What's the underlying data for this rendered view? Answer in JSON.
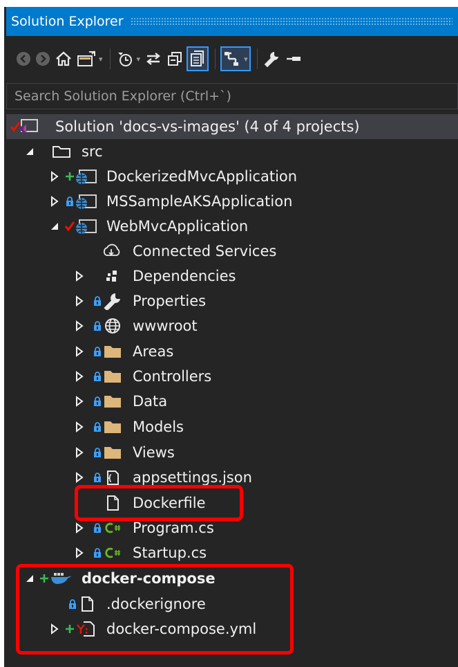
{
  "panel": {
    "title": "Solution Explorer",
    "search_placeholder": "Search Solution Explorer (Ctrl+`)"
  },
  "toolbar": {
    "buttons": [
      {
        "name": "back-icon",
        "state": "disabled"
      },
      {
        "name": "forward-icon",
        "state": "disabled"
      },
      {
        "name": "home-icon",
        "state": "normal"
      },
      {
        "name": "switch-views-icon",
        "state": "normal",
        "dropdown": true
      },
      {
        "name": "pending-changes-filter-icon",
        "state": "normal",
        "dropdown": true
      },
      {
        "name": "sync-with-active-document-icon",
        "state": "normal"
      },
      {
        "name": "collapse-all-icon",
        "state": "normal"
      },
      {
        "name": "show-all-files-icon",
        "state": "pressed"
      },
      {
        "name": "preview-selected-items-icon",
        "state": "pressed",
        "dropdown": true
      },
      {
        "name": "properties-wrench-icon",
        "state": "normal"
      },
      {
        "name": "pin-icon",
        "state": "normal"
      }
    ],
    "dropdown_glyph": "▾"
  },
  "tree": {
    "solution": {
      "label": "Solution 'docs-vs-images' (4 of 4 projects)",
      "status": "checked-in"
    },
    "src": {
      "label": "src",
      "expanded": true
    },
    "projects": [
      {
        "label": "DockerizedMvcApplication",
        "status": "added",
        "expanded": false
      },
      {
        "label": "MSSampleAKSApplication",
        "status": "locked",
        "expanded": false
      },
      {
        "label": "WebMvcApplication",
        "status": "checked-in",
        "expanded": true
      }
    ],
    "web_items": [
      {
        "label": "Connected Services",
        "icon": "connected-services-icon",
        "status": "none",
        "expandable": false
      },
      {
        "label": "Dependencies",
        "icon": "dependencies-icon",
        "status": "none",
        "expandable": true
      },
      {
        "label": "Properties",
        "icon": "wrench-icon",
        "status": "locked",
        "expandable": true
      },
      {
        "label": "wwwroot",
        "icon": "globe-icon",
        "status": "locked",
        "expandable": true
      },
      {
        "label": "Areas",
        "icon": "folder-icon",
        "status": "locked",
        "expandable": true
      },
      {
        "label": "Controllers",
        "icon": "folder-icon",
        "status": "locked",
        "expandable": true
      },
      {
        "label": "Data",
        "icon": "folder-icon",
        "status": "locked",
        "expandable": true
      },
      {
        "label": "Models",
        "icon": "folder-icon",
        "status": "locked",
        "expandable": true
      },
      {
        "label": "Views",
        "icon": "folder-icon",
        "status": "locked",
        "expandable": true
      },
      {
        "label": "appsettings.json",
        "icon": "json-file-icon",
        "status": "locked",
        "expandable": true
      },
      {
        "label": "Dockerfile",
        "icon": "file-icon",
        "status": "none",
        "expandable": false
      },
      {
        "label": "Program.cs",
        "icon": "csharp-file-icon",
        "status": "locked",
        "expandable": true
      },
      {
        "label": "Startup.cs",
        "icon": "csharp-file-icon",
        "status": "locked",
        "expandable": true
      }
    ],
    "compose": {
      "label": "docker-compose",
      "status": "added",
      "expanded": true
    },
    "compose_items": [
      {
        "label": ".dockerignore",
        "icon": "file-icon",
        "status": "locked",
        "expandable": false
      },
      {
        "label": "docker-compose.yml",
        "icon": "yaml-file-icon",
        "status": "added",
        "expandable": true
      }
    ],
    "highlighted": [
      "Dockerfile",
      "docker-compose"
    ]
  },
  "colors": {
    "panel_background": "#252526",
    "title_bar": "#007acc",
    "text": "#f1f1f1",
    "selection": "#3f3f46",
    "highlight_border": "#ff0000",
    "status_lock": "#3aa0ff",
    "status_add": "#3cba54",
    "status_check": "#e51400",
    "folder": "#dcb67a",
    "csharp": "#68b723"
  }
}
